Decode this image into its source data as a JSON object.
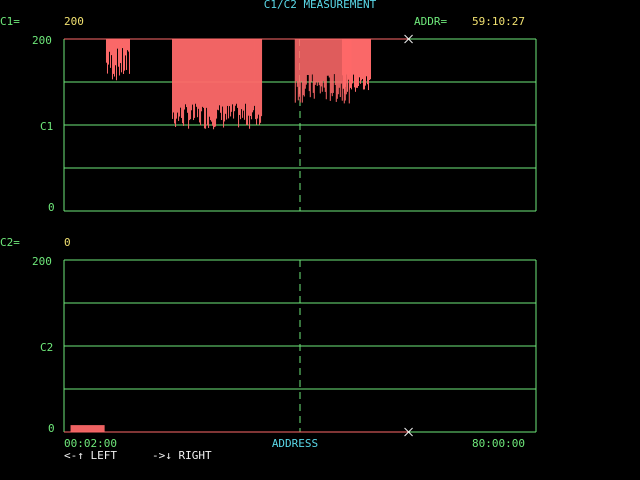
{
  "header": {
    "title": "C1/C2 MEASUREMENT"
  },
  "readout": {
    "c1_label": "C1=",
    "c1_value": "200",
    "addr_label": "ADDR=",
    "addr_value": "59:10:27",
    "c2_label": "C2=",
    "c2_value": "0"
  },
  "graph_top": {
    "max_label": "200",
    "mid_label": "C1",
    "min_label": "0"
  },
  "graph_bottom": {
    "max_label": "200",
    "mid_label": "C2",
    "min_label": "0"
  },
  "x_axis": {
    "start": "00:02:00",
    "label": "ADDRESS",
    "end": "80:00:00"
  },
  "help": {
    "left": "<-↑ LEFT",
    "right": "->↓ RIGHT"
  },
  "colors": {
    "grid": "#6ee87a",
    "trace": "#ff6a6a",
    "title": "#5ad8e8",
    "value": "#f0e070"
  },
  "chart_data": [
    {
      "type": "area",
      "series": [
        {
          "name": "C1",
          "values_note_free": true,
          "segments": [
            {
              "x": [
                0.09,
                0.14
              ],
              "y_min": [
                150,
                190
              ],
              "y_max": 200
            },
            {
              "x": [
                0.23,
                0.42
              ],
              "y_min": [
                95,
                125
              ],
              "y_max": 200
            },
            {
              "x": [
                0.49,
                0.61
              ],
              "y_min": [
                125,
                160
              ],
              "y_max": 200
            },
            {
              "x": [
                0.59,
                0.65
              ],
              "y_min": [
                135,
                160
              ],
              "y_max": 200
            }
          ]
        }
      ],
      "ylim": [
        0,
        200
      ],
      "cursor_x": 0.5
    },
    {
      "type": "area",
      "series": [
        {
          "name": "C2",
          "segments": [
            {
              "x": [
                0.015,
                0.085
              ],
              "y_min": [
                0,
                0
              ],
              "y_max": 8
            }
          ]
        }
      ],
      "ylim": [
        0,
        200
      ],
      "cursor_x": 0.5
    }
  ]
}
